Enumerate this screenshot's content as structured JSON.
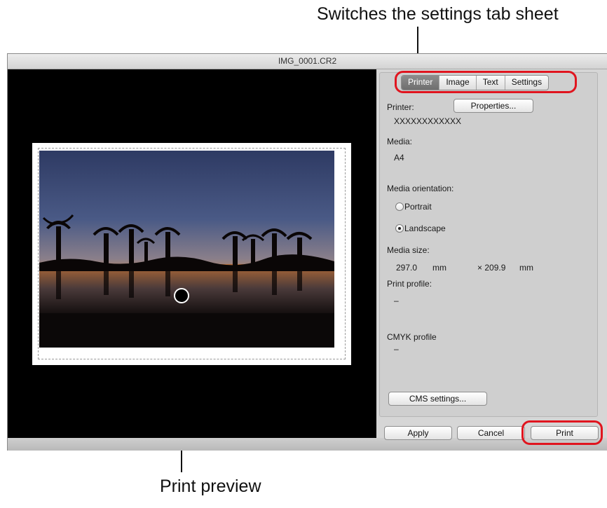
{
  "callouts": {
    "top": "Switches the settings tab sheet",
    "bottom": "Print preview"
  },
  "window": {
    "title": "IMG_0001.CR2"
  },
  "tabs": [
    {
      "label": "Printer",
      "active": true
    },
    {
      "label": "Image",
      "active": false
    },
    {
      "label": "Text",
      "active": false
    },
    {
      "label": "Settings",
      "active": false
    }
  ],
  "printer_tab": {
    "printer_label": "Printer:",
    "properties_button": "Properties...",
    "printer_name": "XXXXXXXXXXXX",
    "media_label": "Media:",
    "media_value": "A4",
    "orientation_label": "Media orientation:",
    "portrait_label": "Portrait",
    "landscape_label": "Landscape",
    "selected_orientation": "Landscape",
    "size_label": "Media size:",
    "width_value": "297.0",
    "width_unit": "mm",
    "height_value": "× 209.9",
    "height_unit": "mm",
    "profile_label": "Print profile:",
    "profile_value": "–",
    "cmyk_label": "CMYK profile",
    "cmyk_value": "–",
    "cms_button": "CMS settings..."
  },
  "footer": {
    "apply": "Apply",
    "cancel": "Cancel",
    "print": "Print"
  },
  "colors": {
    "highlight": "#e0151f",
    "preview_background": "#000000",
    "active_tab": "#7a7a7a"
  }
}
